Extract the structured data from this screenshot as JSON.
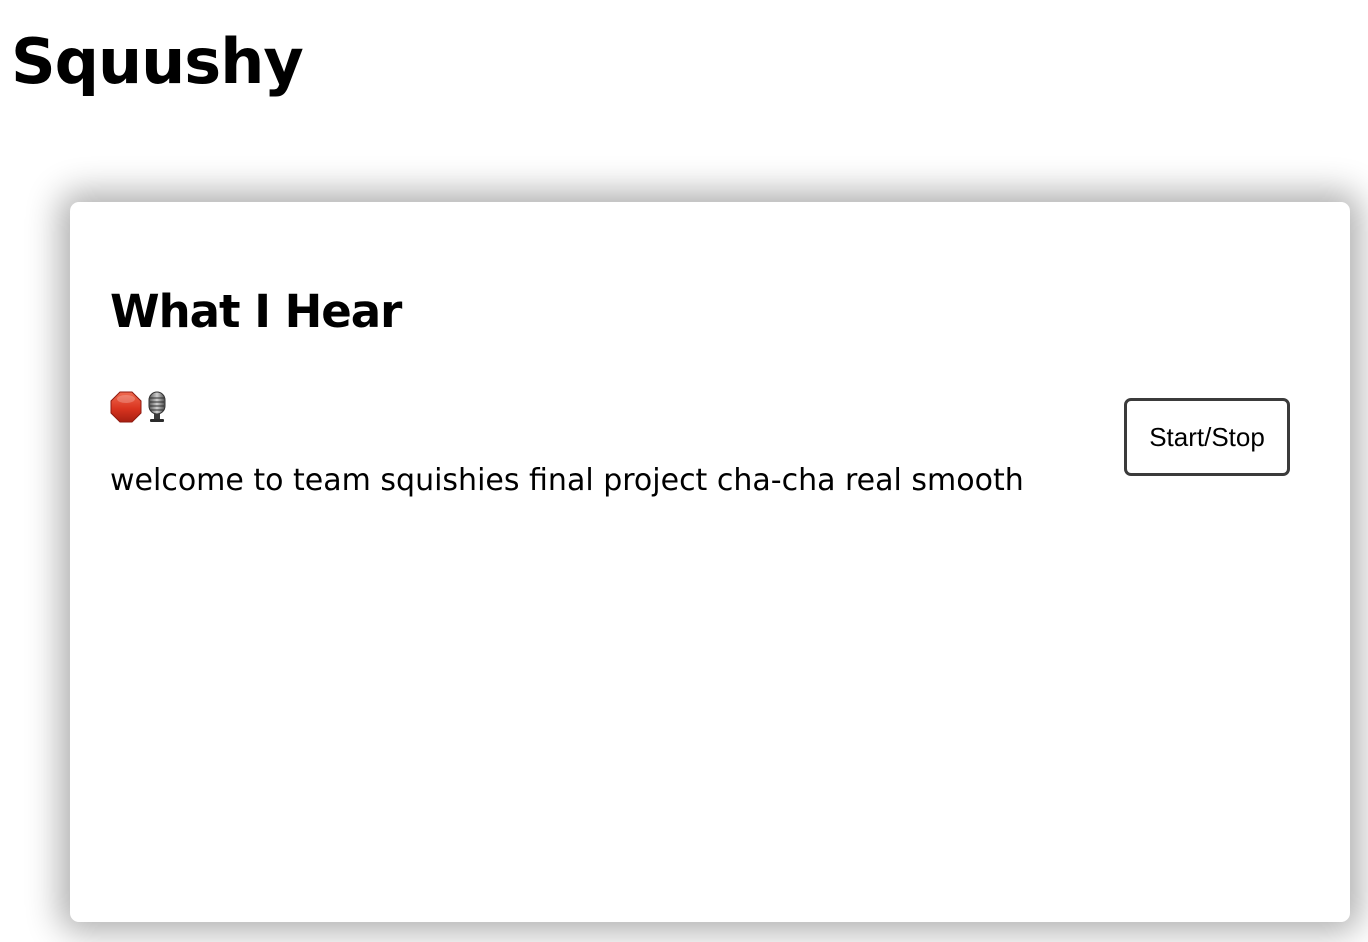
{
  "header": {
    "title": "Squushy"
  },
  "card": {
    "title": "What I Hear",
    "status_icons": [
      {
        "name": "stop-sign-icon",
        "glyph": "🛑",
        "color": "#d9341f"
      },
      {
        "name": "microphone-icon",
        "glyph": "🎙️",
        "color": "#6f6f6f"
      }
    ],
    "transcript": "welcome to team squishies final project cha-cha real smooth",
    "toggle_button_label": "Start/Stop"
  }
}
